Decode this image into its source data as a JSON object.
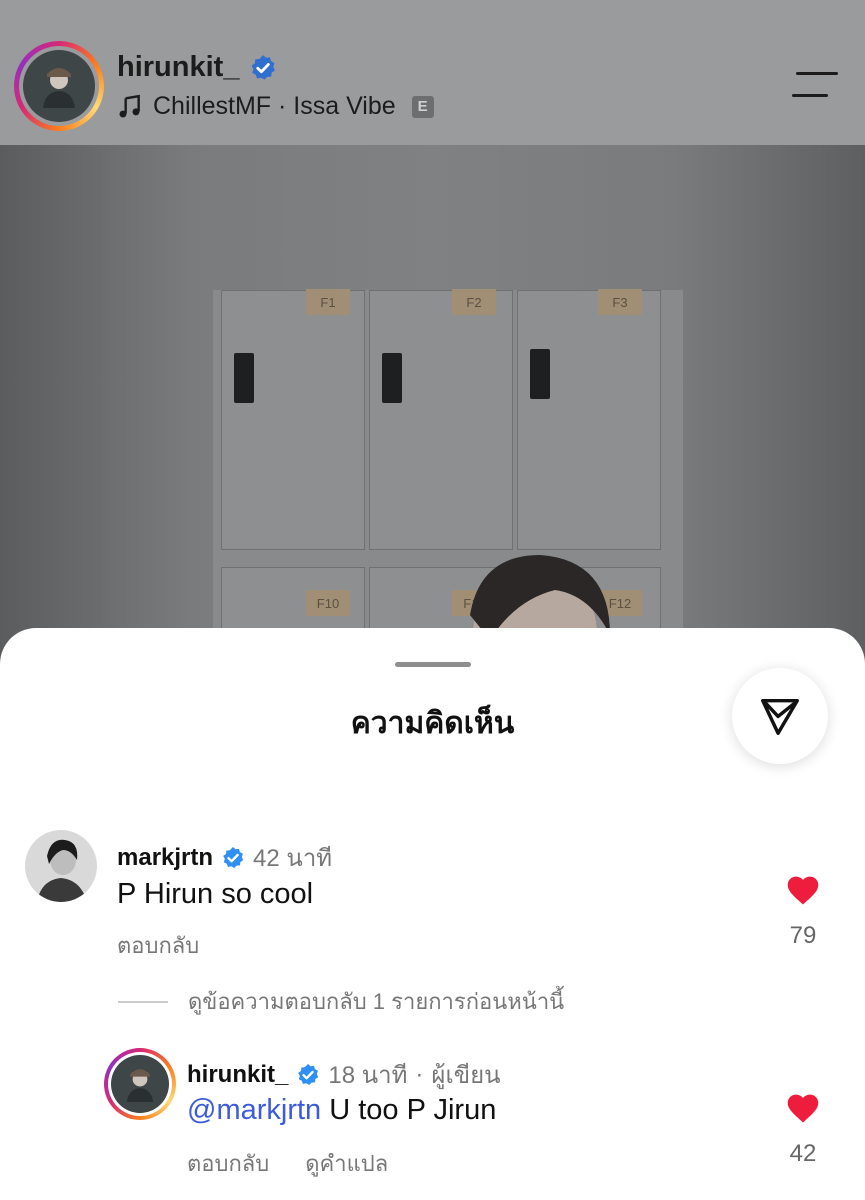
{
  "post": {
    "username": "hirunkit_",
    "music": "ChillestMF · Issa Vibe",
    "explicit_badge": "E",
    "photo_labels": [
      "F1",
      "F2",
      "F3",
      "F10",
      "F11",
      "F12"
    ]
  },
  "comments_sheet": {
    "title": "ความคิดเห็น",
    "comments": [
      {
        "username": "markjrtn",
        "time": "42 นาที",
        "text": "P Hirun so cool",
        "reply_label": "ตอบกลับ",
        "likes": "79"
      }
    ],
    "view_replies": "ดูข้อความตอบกลับ 1 รายการก่อนหน้านี้",
    "reply": {
      "username": "hirunkit_",
      "time": "18 นาที",
      "author_label": "ผู้เขียน",
      "mention": "@markjrtn",
      "text": " U too P Jirun",
      "reply_label": "ตอบกลับ",
      "translate_label": "ดูคำแปล",
      "likes": "42"
    }
  },
  "colors": {
    "verified": "#2f8ff5",
    "heart": "#ee1d3d",
    "mention": "#3b5bdb"
  }
}
